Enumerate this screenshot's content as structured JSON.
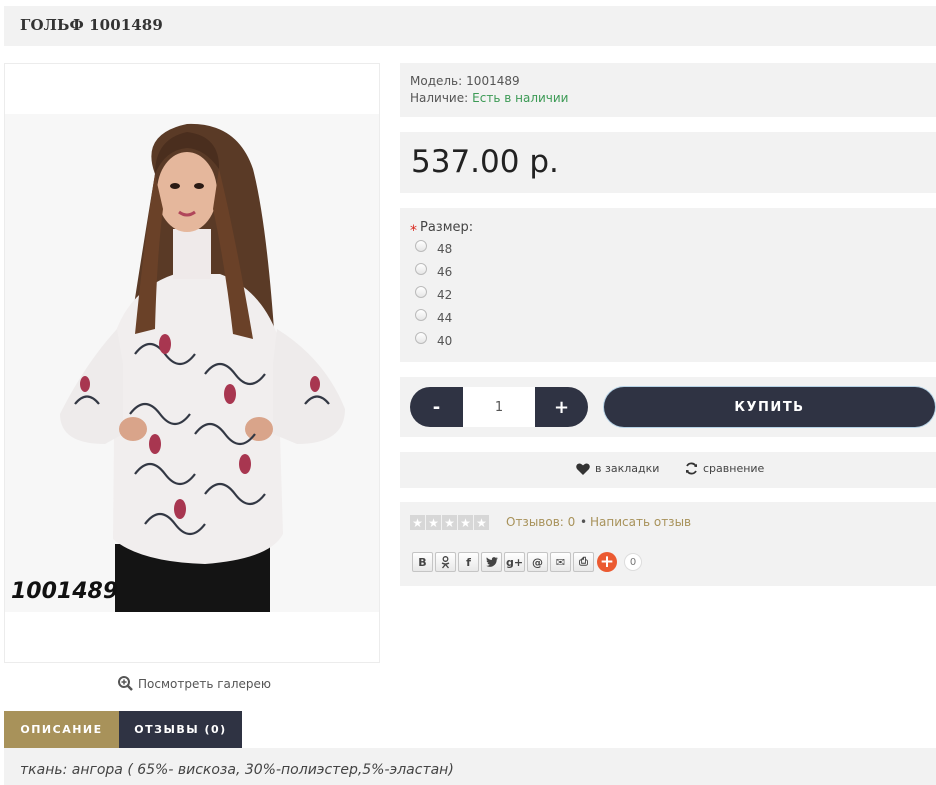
{
  "title": "ГОЛЬФ 1001489",
  "image": {
    "code_overlay": "1001489"
  },
  "gallery_link": "Посмотреть галерею",
  "info": {
    "model_label": "Модель:",
    "model_value": "1001489",
    "stock_label": "Наличие:",
    "stock_value": "Есть в наличии",
    "stock_color": "#3c9a55"
  },
  "price": "537.00 р.",
  "size": {
    "label": "Размер:",
    "required_mark": "*",
    "options": [
      "48",
      "46",
      "42",
      "44",
      "40"
    ]
  },
  "purchase": {
    "minus_label": "-",
    "plus_label": "+",
    "quantity": "1",
    "buy_label": "КУПИТЬ"
  },
  "actions": {
    "wishlist_label": "в закладки",
    "wishlist_icon": "heart-icon",
    "compare_label": "сравнение",
    "compare_icon": "refresh-icon"
  },
  "reviews": {
    "rating": 0,
    "max_rating": 5,
    "reviews_link": "Отзывов: 0",
    "separator": "•",
    "write_link": "Написать отзыв"
  },
  "share": {
    "buttons": [
      {
        "icon": "vk-icon",
        "glyph": "B"
      },
      {
        "icon": "odnoklassniki-icon",
        "glyph": "ok"
      },
      {
        "icon": "facebook-icon",
        "glyph": "f"
      },
      {
        "icon": "twitter-icon",
        "glyph": "t"
      },
      {
        "icon": "google-plus-icon",
        "glyph": "g+"
      },
      {
        "icon": "mail-ru-icon",
        "glyph": "@"
      },
      {
        "icon": "email-icon",
        "glyph": "✉"
      },
      {
        "icon": "print-icon",
        "glyph": "⎙"
      }
    ],
    "count": "0"
  },
  "tabs": {
    "description": "ОПИСАНИЕ",
    "reviews": "ОТЗЫВЫ (0)"
  },
  "description": "ткань: ангора ( 65%- вискоза, 30%-полиэстер,5%-эластан)",
  "colors": {
    "dark": "#2f3343",
    "accent": "#a8925a",
    "panel": "#f2f2f2"
  }
}
